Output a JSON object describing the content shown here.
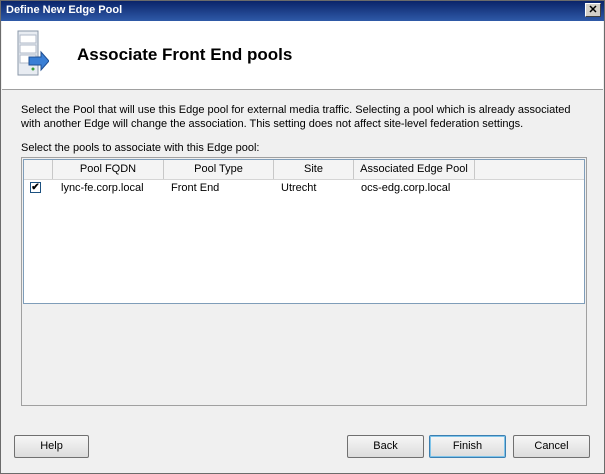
{
  "window": {
    "title": "Define New Edge Pool",
    "close_glyph": "✕"
  },
  "header": {
    "title": "Associate Front End pools",
    "icon": "server-arrow-icon"
  },
  "description": "Select the Pool that will use this Edge pool for external media traffic. Selecting a pool which is already associated with another Edge will change the association. This setting does not affect site-level federation settings.",
  "list": {
    "label": "Select the pools to associate with this Edge pool:",
    "columns": [
      "",
      "Pool FQDN",
      "Pool Type",
      "Site",
      "Associated Edge Pool"
    ],
    "rows": [
      {
        "checked": true,
        "check_glyph": "✔",
        "fqdn": "lync-fe.corp.local",
        "type": "Front End",
        "site": "Utrecht",
        "edge_pool": "ocs-edg.corp.local"
      }
    ]
  },
  "buttons": {
    "help": "Help",
    "back": "Back",
    "finish": "Finish",
    "cancel": "Cancel"
  }
}
